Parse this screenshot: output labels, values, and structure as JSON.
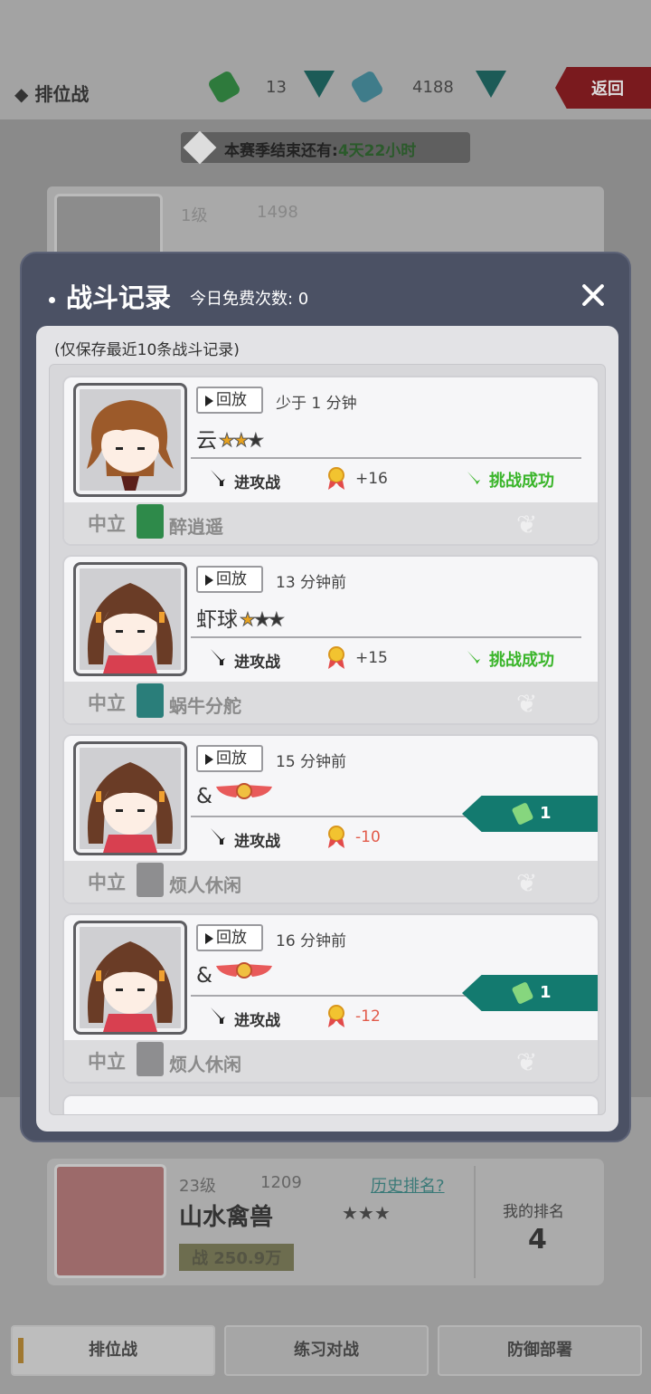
{
  "colors": {
    "accent_green": "#137a6f",
    "success": "#3ab52a",
    "negative": "#e25a4a",
    "modal_bg": "#4b5164"
  },
  "background": {
    "mode_title": "◆ 排位战",
    "resource_1": "13",
    "resource_2": "4188",
    "back_label": "返回",
    "season_label": "本赛季结束还有:",
    "season_value": "4天22小时",
    "top_level": "1级",
    "top_points": "1498",
    "my_level": "23级",
    "my_points": "1209",
    "history_link": "历史排名?",
    "my_name": "山水禽兽",
    "my_power": "战 250.9万",
    "my_rank_label": "我的排名",
    "my_rank": "4",
    "tabs": [
      "排位战",
      "练习对战",
      "防御部署"
    ]
  },
  "modal": {
    "title": "战斗记录",
    "free_count": "今日免费次数: 0",
    "note": "(仅保存最近10条战斗记录)",
    "records": [
      {
        "replay": "回放",
        "time": "少于 1 分钟",
        "opponent": "云",
        "opponent_stars": "★★★",
        "attack": "进攻战",
        "score": "+16",
        "result": "挑战成功",
        "faction": "中立",
        "guild": "醉逍遥"
      },
      {
        "replay": "回放",
        "time": "13 分钟前",
        "opponent": "虾球",
        "opponent_stars": "★★★",
        "attack": "进攻战",
        "score": "+15",
        "result": "挑战成功",
        "faction": "中立",
        "guild": "蜗牛分舵"
      },
      {
        "replay": "回放",
        "time": "15 分钟前",
        "opponent": "&",
        "attack": "进攻战",
        "score": "-10",
        "cost": "1",
        "faction": "中立",
        "guild": "烦人休闲"
      },
      {
        "replay": "回放",
        "time": "16 分钟前",
        "opponent": "&",
        "attack": "进攻战",
        "score": "-12",
        "cost": "1",
        "faction": "中立",
        "guild": "烦人休闲"
      }
    ]
  }
}
